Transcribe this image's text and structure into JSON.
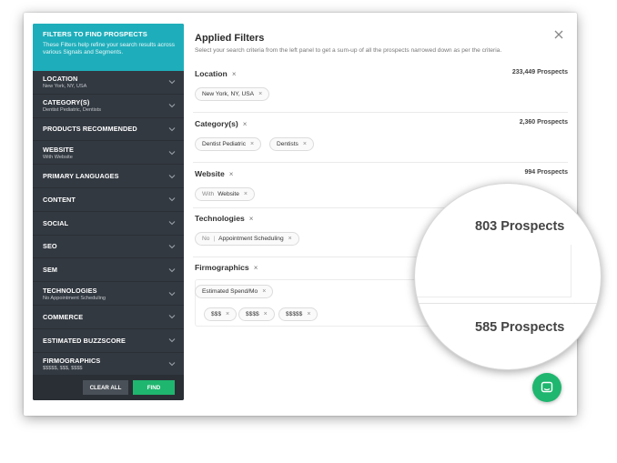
{
  "sidebar": {
    "title": "FILTERS TO FIND PROSPECTS",
    "description": "These Filters help refine your search results across various Signals and Segments.",
    "items": [
      {
        "label": "LOCATION",
        "sub": "New York, NY, USA"
      },
      {
        "label": "CATEGORY(S)",
        "sub": "Dentist Pediatric, Dentists"
      },
      {
        "label": "PRODUCTS RECOMMENDED",
        "sub": ""
      },
      {
        "label": "WEBSITE",
        "sub": "With Website"
      },
      {
        "label": "PRIMARY LANGUAGES",
        "sub": ""
      },
      {
        "label": "CONTENT",
        "sub": ""
      },
      {
        "label": "SOCIAL",
        "sub": ""
      },
      {
        "label": "SEO",
        "sub": ""
      },
      {
        "label": "SEM",
        "sub": ""
      },
      {
        "label": "TECHNOLOGIES",
        "sub": "No Appointment Scheduling"
      },
      {
        "label": "COMMERCE",
        "sub": ""
      },
      {
        "label": "ESTIMATED BUZZSCORE",
        "sub": ""
      },
      {
        "label": "FIRMOGRAPHICS",
        "sub": "$$$$$, $$$, $$$$"
      }
    ],
    "clear_label": "CLEAR ALL",
    "find_label": "FIND"
  },
  "main": {
    "title": "Applied Filters",
    "subtitle": "Select your search criteria from the left panel to get a sum-up of all the prospects narrowed down as per the criteria.",
    "sections": {
      "location": {
        "title": "Location",
        "count": "233,449 Prospects",
        "chips": [
          "New York, NY, USA"
        ]
      },
      "category": {
        "title": "Category(s)",
        "count": "2,360 Prospects",
        "chips": [
          "Dentist Pediatric",
          "Dentists"
        ]
      },
      "website": {
        "title": "Website",
        "count": "994 Prospects",
        "chip_prefix": "With",
        "chips": [
          "Website"
        ]
      },
      "technologies": {
        "title": "Technologies",
        "chip_prefix": "No",
        "chips": [
          "Appointment Scheduling"
        ]
      },
      "firmographics": {
        "title": "Firmographics",
        "group_chip": "Estimated Spend/Mo",
        "chips": [
          "$$$",
          "$$$$",
          "$$$$$"
        ]
      }
    },
    "remove_glyph": "×"
  },
  "magnifier": {
    "technologies_count": "803 Prospects",
    "firmographics_count": "585 Prospects"
  },
  "colors": {
    "sidebar_bg": "#333941",
    "sidebar_header": "#1eaebb",
    "find_button": "#1fb66f",
    "chat_button": "#1fb66f"
  },
  "icons": [
    "chevron-down-icon",
    "close-icon",
    "chat-icon"
  ]
}
